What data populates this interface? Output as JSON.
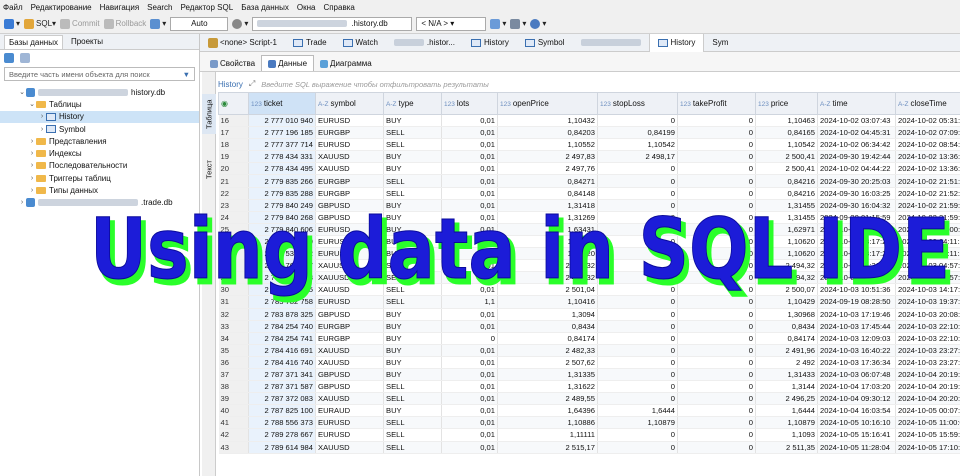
{
  "menu": [
    "Файл",
    "Редактирование",
    "Навигация",
    "Search",
    "Редактор SQL",
    "База данных",
    "Окна",
    "Справка"
  ],
  "toolbar": {
    "sql": "SQL",
    "commit": "Commit",
    "rollback": "Rollback",
    "tx_mode": "Auto",
    "db_name": ".history.db",
    "schema": "< N/A >"
  },
  "left": {
    "tab_db": "Базы данных",
    "tab_projects": "Проекты",
    "filter_placeholder": "Введите часть имени объекта для поиск",
    "tree": {
      "db1": "history.db",
      "tables": "Таблицы",
      "history": "History",
      "symbol": "Symbol",
      "views": "Представления",
      "indexes": "Индексы",
      "sequences": "Последовательности",
      "triggers": "Триггеры таблиц",
      "types": "Типы данных",
      "db2": ".trade.db"
    }
  },
  "editor_tabs": {
    "script": "<none> Script-1",
    "trade": "Trade",
    "watch": "Watch",
    "histor": ".histor...",
    "history": "History",
    "symbol": "Symbol",
    "history2": "History",
    "sym": "Sym"
  },
  "sub_tabs": {
    "props": "Свойства",
    "data": "Данные",
    "diagram": "Диаграмма"
  },
  "side_tabs": {
    "table": "Таблица",
    "text": "Текст"
  },
  "filter": {
    "label": "History",
    "placeholder": "Введите SQL выражение чтобы отфильтровать результаты"
  },
  "overlay_text": "Using data in SQL IDE",
  "columns": [
    "ticket",
    "symbol",
    "type",
    "lots",
    "openPrice",
    "stopLoss",
    "takeProfit",
    "price",
    "time",
    "closeTime"
  ],
  "rows": [
    [
      "16",
      "2 777 010 940",
      "EURUSD",
      "BUY",
      "0,01",
      "1,10432",
      "0",
      "0",
      "1,10463",
      "2024-10-02 03:07:43",
      "2024-10-02 05:31:54"
    ],
    [
      "17",
      "2 777 196 185",
      "EURGBP",
      "SELL",
      "0,01",
      "0,84203",
      "0,84199",
      "0",
      "0,84165",
      "2024-10-02 04:45:31",
      "2024-10-02 07:09:34"
    ],
    [
      "18",
      "2 777 377 714",
      "EURUSD",
      "SELL",
      "0,01",
      "1,10552",
      "1,10542",
      "0",
      "1,10542",
      "2024-10-02 06:34:42",
      "2024-10-02 08:54:16"
    ],
    [
      "19",
      "2 778 434 331",
      "XAUUSD",
      "BUY",
      "0,01",
      "2 497,83",
      "2 498,17",
      "0",
      "2 500,41",
      "2024-09-30 19:42:44",
      "2024-10-02 13:36:14"
    ],
    [
      "20",
      "2 778 434 495",
      "XAUUSD",
      "BUY",
      "0,01",
      "2 497,76",
      "0",
      "0",
      "2 500,41",
      "2024-10-02 04:44:22",
      "2024-10-02 13:36:19"
    ],
    [
      "21",
      "2 779 835 266",
      "EURGBP",
      "SELL",
      "0,01",
      "0,84271",
      "0",
      "0",
      "0,84216",
      "2024-09-30 20:25:03",
      "2024-10-02 21:51:58"
    ],
    [
      "22",
      "2 779 835 288",
      "EURGBP",
      "SELL",
      "0,01",
      "0,84148",
      "0",
      "0",
      "0,84216",
      "2024-09-30 16:03:25",
      "2024-10-02 21:52:01"
    ],
    [
      "23",
      "2 779 840 249",
      "GBPUSD",
      "BUY",
      "0,01",
      "1,31418",
      "0",
      "0",
      "1,31455",
      "2024-09-30 16:04:32",
      "2024-10-02 21:59:50"
    ],
    [
      "24",
      "2 779 840 268",
      "GBPUSD",
      "BUY",
      "0,01",
      "1,31269",
      "0",
      "0",
      "1,31455",
      "2024-09-30 01:15:59",
      "2024-10-02 21:59:53"
    ],
    [
      "25",
      "2 779 840 606",
      "EURUSD",
      "BUY",
      "0,01",
      "1,63431",
      "0",
      "0",
      "1,62971",
      "2024-10-03 04:11:26",
      "2024-10-03 02:00:13"
    ],
    [
      "26",
      "2 780 159 509",
      "EURUSD",
      "BUY",
      "0,01",
      "1,10620",
      "0",
      "0",
      "1,10620",
      "2024-10-03 03:17:21",
      "2024-10-03 04:11:23"
    ],
    [
      "27",
      "2 780 537 222",
      "EURUSD",
      "BUY",
      "0,01",
      "1,10620",
      "0",
      "0",
      "1,10620",
      "2024-10-03 03:17:21",
      "2024-10-03 04:11:23"
    ],
    [
      "28",
      "2 780 769 677",
      "XAUUSD",
      "SELL",
      "0,01",
      "2 494,32",
      "0",
      "0",
      "2 494,32",
      "2024-10-03 04:36:35",
      "2024-10-03 04:57:27"
    ],
    [
      "29",
      "2 780 769 678",
      "XAUUSD",
      "SELL",
      "0",
      "2 494,32",
      "0",
      "0",
      "2 494,32",
      "2024-10-03 04:36:35",
      "2024-10-03 04:57:27"
    ],
    [
      "30",
      "2 782 005 055",
      "XAUUSD",
      "SELL",
      "0,01",
      "2 501,04",
      "0",
      "0",
      "2 500,07",
      "2024-10-03 10:51:36",
      "2024-10-03 14:17:33"
    ],
    [
      "31",
      "2 783 782 758",
      "EURUSD",
      "SELL",
      "1,1",
      "1,10416",
      "0",
      "0",
      "1,10429",
      "2024-09-19 08:28:50",
      "2024-10-03 19:37:16"
    ],
    [
      "32",
      "2 783 878 325",
      "GBPUSD",
      "BUY",
      "0,01",
      "1,3094",
      "0",
      "0",
      "1,30968",
      "2024-10-03 17:19:46",
      "2024-10-03 20:08:01"
    ],
    [
      "33",
      "2 784 254 740",
      "EURGBP",
      "BUY",
      "0,01",
      "0,8434",
      "0",
      "0",
      "0,8434",
      "2024-10-03 17:45:44",
      "2024-10-03 22:10:09"
    ],
    [
      "34",
      "2 784 254 741",
      "EURGBP",
      "BUY",
      "0",
      "0,84174",
      "0",
      "0",
      "0,84174",
      "2024-10-03 12:09:03",
      "2024-10-03 22:10:09"
    ],
    [
      "35",
      "2 784 416 691",
      "XAUUSD",
      "BUY",
      "0,01",
      "2 482,33",
      "0",
      "0",
      "2 491,96",
      "2024-10-03 16:40:22",
      "2024-10-03 23:27:46"
    ],
    [
      "36",
      "2 784 416 740",
      "XAUUSD",
      "BUY",
      "0,01",
      "2 507,62",
      "0",
      "0",
      "2 492",
      "2024-10-03 17:36:34",
      "2024-10-03 23:27:49"
    ],
    [
      "37",
      "2 787 371 341",
      "GBPUSD",
      "BUY",
      "0,01",
      "1,31335",
      "0",
      "0",
      "1,31433",
      "2024-10-03 06:07:48",
      "2024-10-04 20:19:43"
    ],
    [
      "38",
      "2 787 371 587",
      "GBPUSD",
      "SELL",
      "0,01",
      "1,31622",
      "0",
      "0",
      "1,3144",
      "2024-10-04 17:03:20",
      "2024-10-04 20:19:49"
    ],
    [
      "39",
      "2 787 372 083",
      "XAUUSD",
      "SELL",
      "0,01",
      "2 489,55",
      "0",
      "0",
      "2 496,25",
      "2024-10-04 09:30:12",
      "2024-10-04 20:20:01"
    ],
    [
      "40",
      "2 787 825 100",
      "EURAUD",
      "BUY",
      "0,01",
      "1,64396",
      "1,6444",
      "0",
      "1,6444",
      "2024-10-04 16:03:54",
      "2024-10-05 00:07:31"
    ],
    [
      "41",
      "2 788 556 373",
      "EURUSD",
      "SELL",
      "0,01",
      "1,10886",
      "1,10879",
      "0",
      "1,10879",
      "2024-10-05 10:16:10",
      "2024-10-05 11:00:05"
    ],
    [
      "42",
      "2 789 278 667",
      "EURUSD",
      "SELL",
      "0,01",
      "1,11111",
      "0",
      "0",
      "1,1093",
      "2024-10-05 15:16:41",
      "2024-10-05 15:59:22"
    ],
    [
      "43",
      "2 789 614 984",
      "XAUUSD",
      "SELL",
      "0,01",
      "2 515,17",
      "0",
      "0",
      "2 511,35",
      "2024-10-05 11:28:04",
      "2024-10-05 17:10:59"
    ]
  ]
}
